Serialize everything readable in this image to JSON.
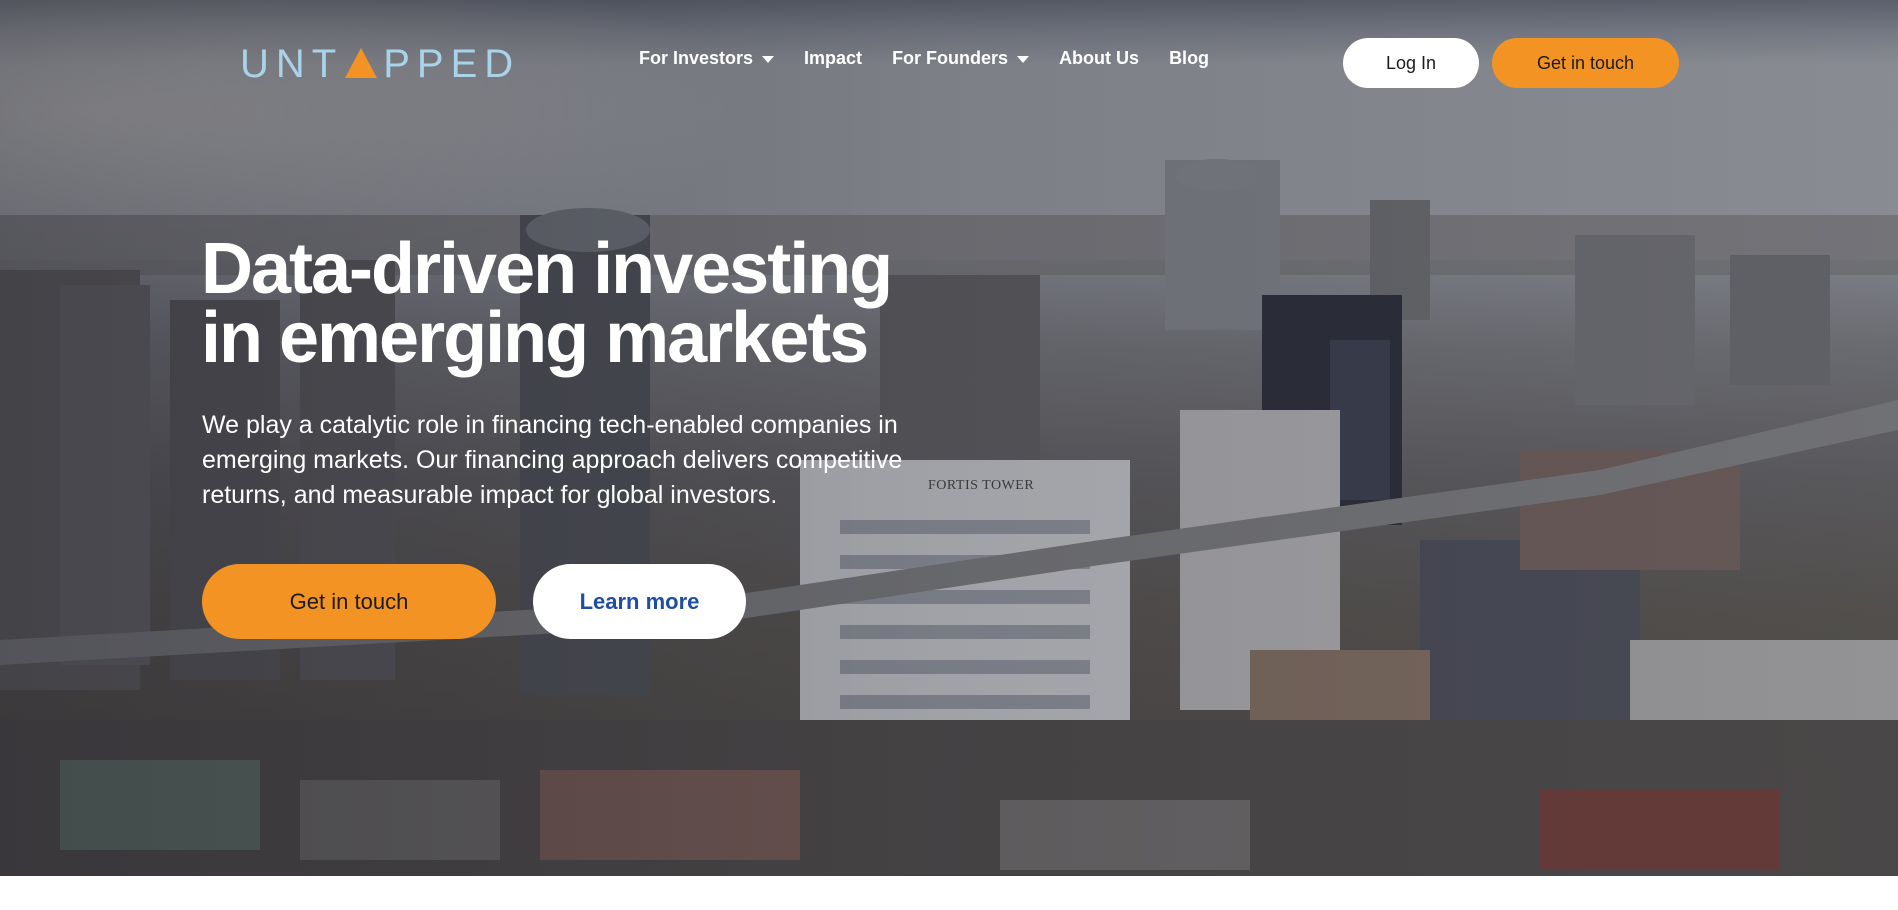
{
  "brand": {
    "logo_text_before": "UNT",
    "logo_text_after": "PPED",
    "logo_color": "#a9d3e8",
    "accent_color": "#f39323"
  },
  "nav": {
    "items": [
      {
        "label": "For Investors",
        "has_dropdown": true
      },
      {
        "label": "Impact",
        "has_dropdown": false
      },
      {
        "label": "For Founders",
        "has_dropdown": true
      },
      {
        "label": "About Us",
        "has_dropdown": false
      },
      {
        "label": "Blog",
        "has_dropdown": false
      }
    ],
    "login_label": "Log In",
    "contact_label": "Get in touch"
  },
  "hero": {
    "headline_line1": "Data-driven investing",
    "headline_line2": "in emerging markets",
    "subtext": "We play a catalytic role in financing tech-enabled companies in emerging markets. Our financing approach delivers competitive returns, and measurable impact for global investors.",
    "primary_cta": "Get in touch",
    "secondary_cta": "Learn more",
    "background_sign_text": "FORTIS TOWER",
    "secondary_cta_text_color": "#1f4ea1"
  }
}
